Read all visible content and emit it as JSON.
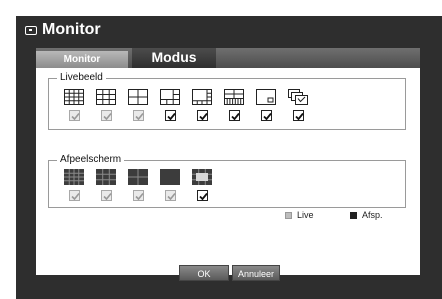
{
  "window": {
    "title": "Monitor"
  },
  "tabs": [
    {
      "label": "Monitor",
      "active": false
    },
    {
      "label": "Modus",
      "active": true
    }
  ],
  "livebeeld": {
    "label": "Livebeeld",
    "options": [
      {
        "icon": "split-16-icon",
        "checked": false
      },
      {
        "icon": "split-9-icon",
        "checked": false
      },
      {
        "icon": "split-4-icon",
        "checked": false
      },
      {
        "icon": "split-6-icon",
        "checked": true
      },
      {
        "icon": "split-8-icon",
        "checked": true
      },
      {
        "icon": "split-13-icon",
        "checked": true
      },
      {
        "icon": "pip-icon",
        "checked": true
      },
      {
        "icon": "sequence-icon",
        "checked": true
      }
    ]
  },
  "afspeelscherm": {
    "label": "Afpeelscherm",
    "options": [
      {
        "icon": "split-16-icon",
        "checked": false
      },
      {
        "icon": "split-9-icon",
        "checked": false
      },
      {
        "icon": "split-4-icon",
        "checked": false
      },
      {
        "icon": "single-icon",
        "checked": false
      },
      {
        "icon": "split-6-icon",
        "checked": true
      }
    ]
  },
  "legend": {
    "live": "Live",
    "afsp": "Afsp."
  },
  "colors": {
    "live": "#bdbdbd",
    "afsp": "#222222",
    "frame": "#2e2e2e"
  },
  "buttons": {
    "ok": "OK",
    "cancel": "Annuleer"
  }
}
